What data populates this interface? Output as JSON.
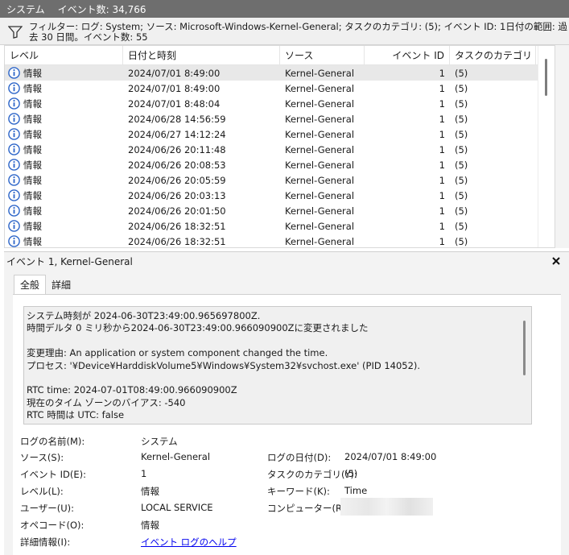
{
  "window": {
    "title": "システム",
    "event_count": "イベント数: 34,766"
  },
  "filter": {
    "text": "フィルター: ログ: System; ソース: Microsoft-Windows-Kernel-General; タスクのカテゴリ: (5); イベント ID: 1日付の範囲: 過去 30 日間。イベント数: 55"
  },
  "grid": {
    "columns": [
      "レベル",
      "日付と時刻",
      "ソース",
      "イベント ID",
      "タスクのカテゴリ"
    ],
    "rows": [
      {
        "level": "情報",
        "date": "2024/07/01 8:49:00",
        "source": "Kernel-General",
        "id": "1",
        "category": "(5)"
      },
      {
        "level": "情報",
        "date": "2024/07/01 8:49:00",
        "source": "Kernel-General",
        "id": "1",
        "category": "(5)"
      },
      {
        "level": "情報",
        "date": "2024/07/01 8:48:04",
        "source": "Kernel-General",
        "id": "1",
        "category": "(5)"
      },
      {
        "level": "情報",
        "date": "2024/06/28 14:56:59",
        "source": "Kernel-General",
        "id": "1",
        "category": "(5)"
      },
      {
        "level": "情報",
        "date": "2024/06/27 14:12:24",
        "source": "Kernel-General",
        "id": "1",
        "category": "(5)"
      },
      {
        "level": "情報",
        "date": "2024/06/26 20:11:48",
        "source": "Kernel-General",
        "id": "1",
        "category": "(5)"
      },
      {
        "level": "情報",
        "date": "2024/06/26 20:08:53",
        "source": "Kernel-General",
        "id": "1",
        "category": "(5)"
      },
      {
        "level": "情報",
        "date": "2024/06/26 20:05:59",
        "source": "Kernel-General",
        "id": "1",
        "category": "(5)"
      },
      {
        "level": "情報",
        "date": "2024/06/26 20:03:13",
        "source": "Kernel-General",
        "id": "1",
        "category": "(5)"
      },
      {
        "level": "情報",
        "date": "2024/06/26 20:01:50",
        "source": "Kernel-General",
        "id": "1",
        "category": "(5)"
      },
      {
        "level": "情報",
        "date": "2024/06/26 18:32:51",
        "source": "Kernel-General",
        "id": "1",
        "category": "(5)"
      },
      {
        "level": "情報",
        "date": "2024/06/26 18:32:51",
        "source": "Kernel-General",
        "id": "1",
        "category": "(5)"
      }
    ]
  },
  "detail": {
    "header": "イベント 1, Kernel-General",
    "tabs": [
      "全般",
      "詳細"
    ],
    "description": [
      "システム時刻が 2024-06-30T23:49:00.965697800Z.",
      "時間デルタ 0 ミリ秒から2024-06-30T23:49:00.966090900Zに変更されました",
      "",
      "変更理由: An application or system component changed the time.",
      "プロセス: '¥Device¥HarddiskVolume5¥Windows¥System32¥svchost.exe' (PID 14052).",
      "",
      "RTC time: 2024-07-01T08:49:00.966090900Z",
      "現在のタイム ゾーンのバイアス: -540",
      "RTC 時間は UTC: false"
    ],
    "properties": {
      "log_name_label": "ログの名前(M):",
      "log_name_value": "システム",
      "source_label": "ソース(S):",
      "source_value": "Kernel-General",
      "logged_label": "ログの日付(D):",
      "logged_value": "2024/07/01 8:49:00",
      "event_id_label": "イベント ID(E):",
      "event_id_value": "1",
      "task_label": "タスクのカテゴリ(Y):",
      "task_value": "(5)",
      "level_label": "レベル(L):",
      "level_value": "情報",
      "keyword_label": "キーワード(K):",
      "keyword_value": "Time",
      "user_label": "ユーザー(U):",
      "user_value": "LOCAL SERVICE",
      "computer_label": "コンピューター(R):",
      "opcode_label": "オペコード(O):",
      "opcode_value": "情報",
      "more_label": "詳細情報(I):",
      "more_link": "イベント ログのヘルプ"
    }
  },
  "colors": {
    "title_bar": "#6e6e6e",
    "info_icon": "#2b64c8",
    "link": "#0000ee",
    "selected_row": "#e8e8e8"
  }
}
